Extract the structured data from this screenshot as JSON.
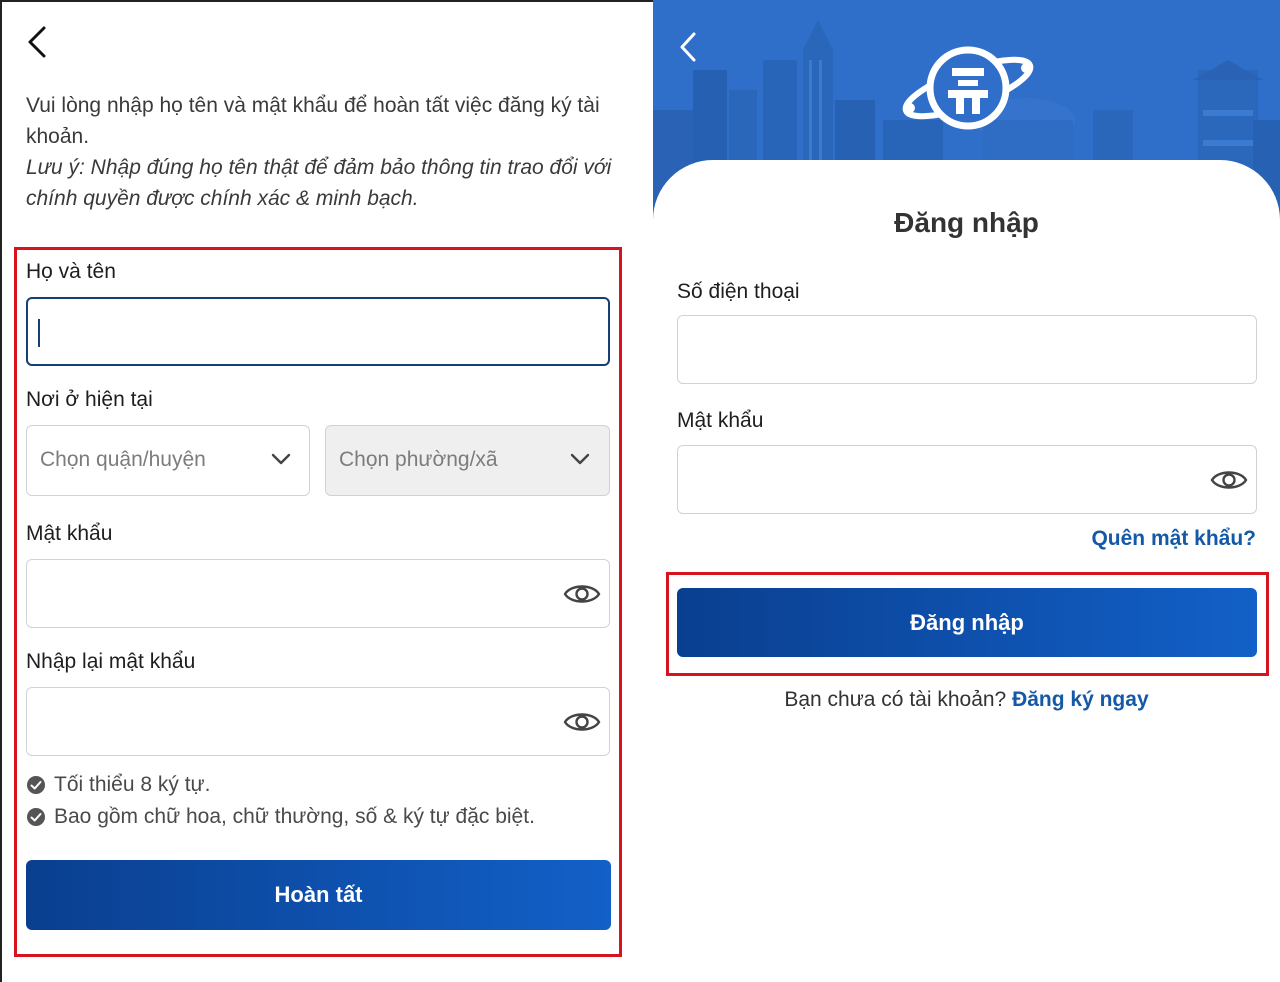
{
  "register": {
    "intro_text": "Vui lòng nhập họ tên và mật khẩu để hoàn tất việc đăng ký tài khoản.",
    "note_text": "Lưu ý: Nhập đúng họ tên thật để đảm bảo thông tin trao đổi với chính quyền được chính xác & minh bạch.",
    "fullname_label": "Họ và tên",
    "fullname_value": "",
    "residence_label": "Nơi ở hiện tại",
    "district_placeholder": "Chọn quận/huyện",
    "ward_placeholder": "Chọn phường/xã",
    "password_label": "Mật khẩu",
    "confirm_password_label": "Nhập lại mật khẩu",
    "rules": [
      "Tối thiểu 8 ký tự.",
      "Bao gồm chữ hoa, chữ thường, số & ký tự đặc biệt."
    ],
    "submit_label": "Hoàn tất"
  },
  "login": {
    "title": "Đăng nhập",
    "phone_label": "Số điện thoại",
    "phone_value": "",
    "password_label": "Mật khẩu",
    "forgot_label": "Quên mật khẩu?",
    "submit_label": "Đăng nhập",
    "no_account_text": "Bạn chưa có tài khoản?",
    "signup_link": "Đăng ký ngay"
  },
  "icons": {
    "back": "chevron-left-icon",
    "dropdown": "chevron-down-icon",
    "eye": "eye-icon",
    "check": "check-circle-icon",
    "emblem": "hanoi-emblem-icon"
  },
  "colors": {
    "primary": "#1459a8",
    "banner": "#2c6cc7",
    "highlight": "#d7141d"
  }
}
